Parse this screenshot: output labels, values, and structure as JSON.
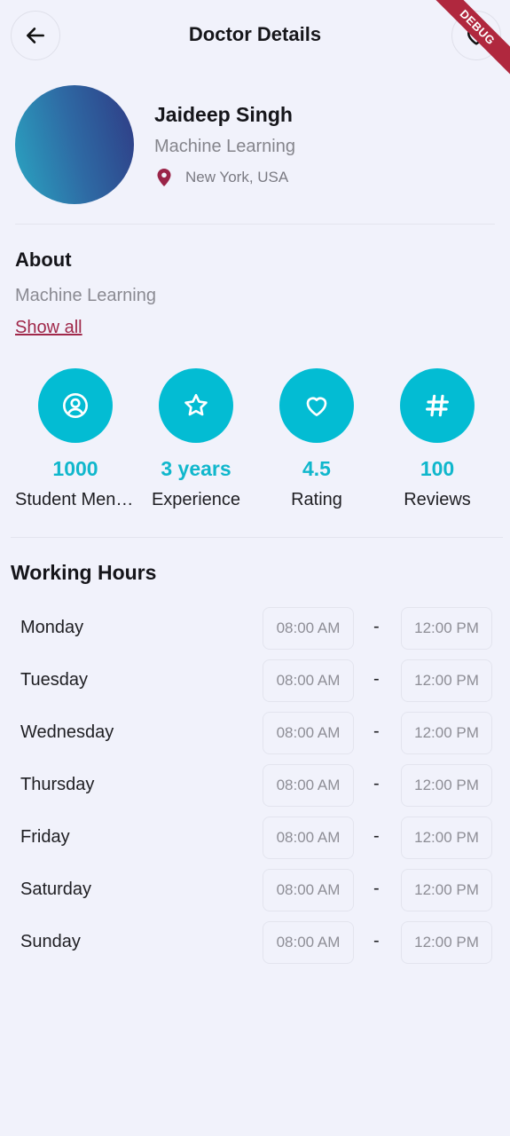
{
  "header": {
    "title": "Doctor Details",
    "debug_banner": "DEBUG"
  },
  "profile": {
    "name": "Jaideep Singh",
    "specialty": "Machine Learning",
    "location": "New York, USA"
  },
  "about": {
    "title": "About",
    "text": "Machine Learning",
    "show_all": "Show all"
  },
  "stats": [
    {
      "icon": "user-circle-icon",
      "value": "1000",
      "label": "Student Mentored"
    },
    {
      "icon": "star-icon",
      "value": "3 years",
      "label": "Experience"
    },
    {
      "icon": "heart-icon",
      "value": "4.5",
      "label": "Rating"
    },
    {
      "icon": "hash-icon",
      "value": "100",
      "label": "Reviews"
    }
  ],
  "working_hours": {
    "title": "Working Hours",
    "separator": "-",
    "days": [
      {
        "day": "Monday",
        "start": "08:00 AM",
        "end": "12:00 PM"
      },
      {
        "day": "Tuesday",
        "start": "08:00 AM",
        "end": "12:00 PM"
      },
      {
        "day": "Wednesday",
        "start": "08:00 AM",
        "end": "12:00 PM"
      },
      {
        "day": "Thursday",
        "start": "08:00 AM",
        "end": "12:00 PM"
      },
      {
        "day": "Friday",
        "start": "08:00 AM",
        "end": "12:00 PM"
      },
      {
        "day": "Saturday",
        "start": "08:00 AM",
        "end": "12:00 PM"
      },
      {
        "day": "Sunday",
        "start": "08:00 AM",
        "end": "12:00 PM"
      }
    ]
  },
  "colors": {
    "accent": "#03bcd3",
    "link": "#a0284a",
    "background": "#f1f2fb"
  }
}
